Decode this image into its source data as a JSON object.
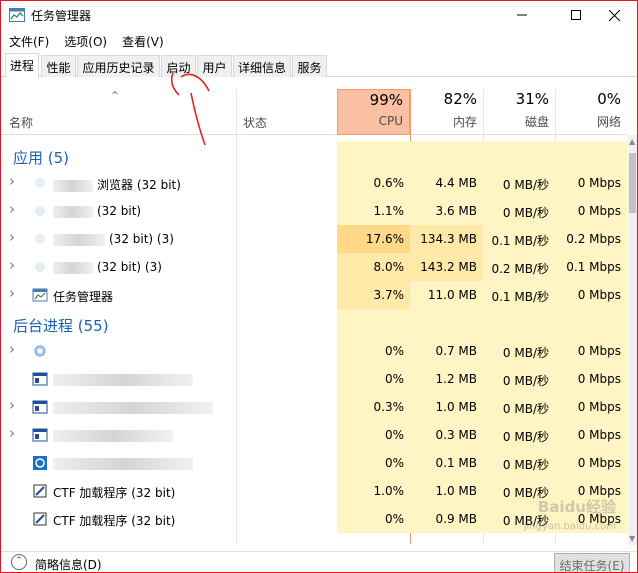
{
  "window": {
    "title": "任务管理器"
  },
  "menu": [
    "文件(F)",
    "选项(O)",
    "查看(V)"
  ],
  "tabs": [
    "进程",
    "性能",
    "应用历史记录",
    "启动",
    "用户",
    "详细信息",
    "服务"
  ],
  "active_tab": "进程",
  "columns": {
    "name": "名称",
    "status": "状态",
    "cpu": {
      "pct": "99%",
      "label": "CPU"
    },
    "mem": {
      "pct": "82%",
      "label": "内存"
    },
    "disk": {
      "pct": "31%",
      "label": "磁盘"
    },
    "net": {
      "pct": "0%",
      "label": "网络"
    }
  },
  "sections": {
    "apps": "应用 (5)",
    "background": "后台进程 (55)"
  },
  "apps": [
    {
      "name": "浏览器 (32 bit)",
      "cpu": "0.6%",
      "mem": "4.4 MB",
      "disk": "0 MB/秒",
      "net": "0 Mbps"
    },
    {
      "name": "(32 bit)",
      "cpu": "1.1%",
      "mem": "3.6 MB",
      "disk": "0 MB/秒",
      "net": "0 Mbps"
    },
    {
      "name": "(32 bit) (3)",
      "cpu": "17.6%",
      "mem": "134.3 MB",
      "disk": "0.1 MB/秒",
      "net": "0.2 Mbps"
    },
    {
      "name": "(32 bit) (3)",
      "cpu": "8.0%",
      "mem": "143.2 MB",
      "disk": "0.2 MB/秒",
      "net": "0.1 Mbps"
    },
    {
      "name": "任务管理器",
      "cpu": "3.7%",
      "mem": "11.0 MB",
      "disk": "0.1 MB/秒",
      "net": "0 Mbps"
    }
  ],
  "background": [
    {
      "name": "",
      "cpu": "0%",
      "mem": "0.7 MB",
      "disk": "0 MB/秒",
      "net": "0 Mbps"
    },
    {
      "name": "",
      "cpu": "0%",
      "mem": "1.2 MB",
      "disk": "0 MB/秒",
      "net": "0 Mbps"
    },
    {
      "name": "",
      "cpu": "0.3%",
      "mem": "1.0 MB",
      "disk": "0 MB/秒",
      "net": "0 Mbps"
    },
    {
      "name": "",
      "cpu": "0%",
      "mem": "0.3 MB",
      "disk": "0 MB/秒",
      "net": "0 Mbps"
    },
    {
      "name": "",
      "cpu": "0%",
      "mem": "0.1 MB",
      "disk": "0 MB/秒",
      "net": "0 Mbps"
    },
    {
      "name": "CTF 加载程序 (32 bit)",
      "cpu": "1.0%",
      "mem": "1.0 MB",
      "disk": "0 MB/秒",
      "net": "0 Mbps"
    },
    {
      "name": "CTF 加载程序 (32 bit)",
      "cpu": "0%",
      "mem": "0.9 MB",
      "disk": "0 MB/秒",
      "net": "0 Mbps"
    }
  ],
  "footer": {
    "details": "简略信息(D)",
    "end_task": "结束任务(E)"
  },
  "watermark": {
    "line1": "Baidu经验",
    "line2": "jingyan.baidu.com"
  },
  "colors": {
    "accent": "#1a5fb4",
    "cpu_header": "#f9c0a4",
    "heat_low": "#fff4c4",
    "heat_mid": "#ffe9a8",
    "heat_high": "#ffd88a"
  }
}
